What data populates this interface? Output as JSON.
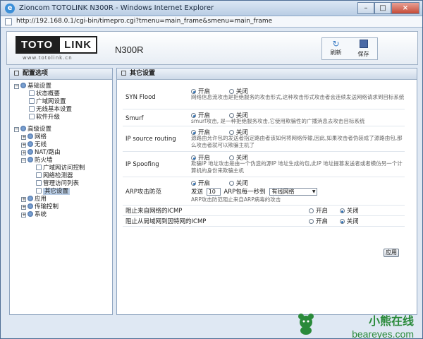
{
  "window": {
    "title": "Zioncom TOTOLINK N300R - Windows Internet Explorer",
    "minimize": "–",
    "maximize": "□",
    "close": "×"
  },
  "address": {
    "url": "http://192.168.0.1/cgi-bin/timepro.cgi?tmenu=main_frame&smenu=main_frame"
  },
  "header": {
    "logo_left": "TOTO",
    "logo_right": "LINK",
    "logo_url": "www.totolink.cn",
    "model": "N300R",
    "refresh_label": "刷新",
    "save_label": "保存"
  },
  "left_panel": {
    "title": "配置选项",
    "tree": [
      {
        "label": "基础设置",
        "level": 0,
        "expander": "−",
        "icon": "gear"
      },
      {
        "label": "状态概要",
        "level": 1,
        "icon": "doc"
      },
      {
        "label": "广域网设置",
        "level": 1,
        "icon": "doc"
      },
      {
        "label": "无线基本设置",
        "level": 1,
        "icon": "doc"
      },
      {
        "label": "软件升级",
        "level": 1,
        "icon": "doc"
      },
      {
        "label": "",
        "level": 0,
        "spacer": true
      },
      {
        "label": "高级设置",
        "level": 0,
        "expander": "−",
        "icon": "gear"
      },
      {
        "label": "网络",
        "level": 1,
        "expander": "+",
        "icon": "gear"
      },
      {
        "label": "无线",
        "level": 1,
        "expander": "+",
        "icon": "gear"
      },
      {
        "label": "NAT/路由",
        "level": 1,
        "expander": "+",
        "icon": "gear"
      },
      {
        "label": "防火墙",
        "level": 1,
        "expander": "−",
        "icon": "gear"
      },
      {
        "label": "广域网访问控制",
        "level": 2,
        "icon": "doc"
      },
      {
        "label": "网络检测器",
        "level": 2,
        "icon": "doc"
      },
      {
        "label": "管理访问列表",
        "level": 2,
        "icon": "doc"
      },
      {
        "label": "其它设置",
        "level": 2,
        "icon": "doc",
        "selected": true
      },
      {
        "label": "应用",
        "level": 1,
        "expander": "+",
        "icon": "gear"
      },
      {
        "label": "传输控制",
        "level": 1,
        "expander": "+",
        "icon": "gear"
      },
      {
        "label": "系统",
        "level": 1,
        "expander": "+",
        "icon": "gear"
      }
    ]
  },
  "right_panel": {
    "title": "其它设置",
    "on_label": "开启",
    "off_label": "关闭",
    "settings": [
      {
        "name": "SYN Flood",
        "selected": "on",
        "desc": "网络信息流攻击是拒绝服务的攻击形式,这种攻击形式攻击者会连续发送网络请求到目标系统"
      },
      {
        "name": "Smurf",
        "selected": "on",
        "desc": "smurf攻击, 是一种拒绝服务攻击,它使用欺骗性的广播消息去攻击目标系统"
      },
      {
        "name": "IP source routing",
        "selected": "on",
        "desc": "源路由允许包的发送者指定路由者该如何将网络传输,因此,如果攻击者伪装成了源路由包,那么攻击者就可以欺骗主机了"
      },
      {
        "name": "IP Spoofing",
        "selected": "on",
        "desc": "欺骗IP 地址攻击是由一个伪造的源IP 地址生成的包,此IP 地址提篡发送者或者模仿另一个计算机的身份来欺骗主机"
      }
    ],
    "arp": {
      "name": "ARP攻击防范",
      "selected": "on",
      "send_label": "发送",
      "count_value": "10",
      "per_second_label": "ARP包每一秒到",
      "target_value": "有线网络",
      "desc": "ARP攻击防范阻止来自ARP病毒的攻击"
    },
    "icmp": [
      {
        "label": "阻止来自网络的ICMP",
        "selected": "off"
      },
      {
        "label": "阻止从局域网到因特网的ICMP",
        "selected": "off"
      }
    ],
    "apply_label": "应用"
  },
  "watermark": {
    "cn": "小熊在线",
    "en": "beareyes.com"
  },
  "colors": {
    "accent": "#2a6fb6",
    "panel_border": "#8fa5c0",
    "watermark": "#2a8a3a"
  }
}
